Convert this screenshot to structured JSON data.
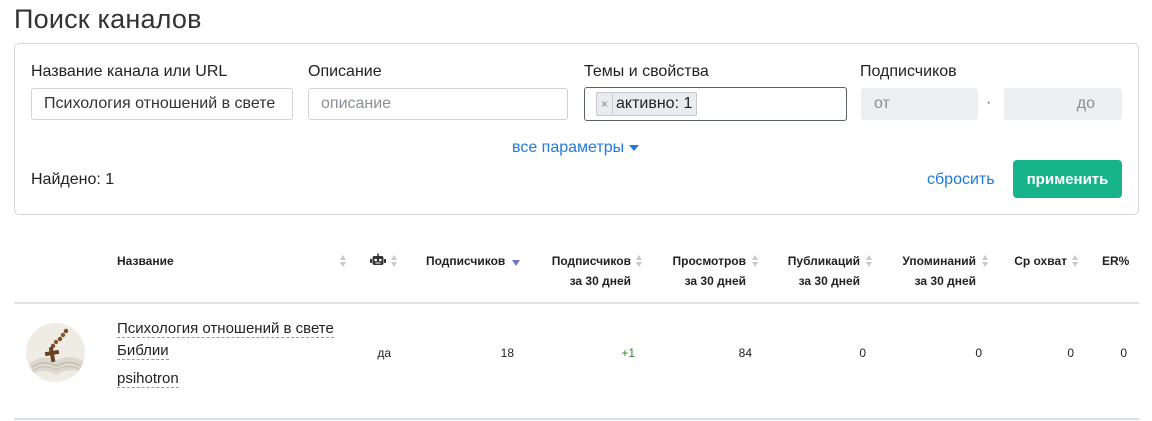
{
  "page": {
    "title": "Поиск каналов"
  },
  "filters": {
    "name_label": "Название канала или URL",
    "name_value": "Психология отношений в свете",
    "description_label": "Описание",
    "description_placeholder": "описание",
    "topics_label": "Темы и свойства",
    "topic_tag": "активно: 1",
    "topic_tag_remove": "×",
    "subscribers_label": "Подписчиков",
    "from_placeholder": "от",
    "to_placeholder": "до",
    "range_separator": "·",
    "all_params": "все параметры",
    "found": "Найдено: 1",
    "reset": "сбросить",
    "apply": "применить"
  },
  "table": {
    "headers": {
      "name": "Название",
      "subscribers": "Подписчиков",
      "subs30_1": "Подписчиков",
      "subs30_2": "за 30 дней",
      "views30_1": "Просмотров",
      "views30_2": "за 30 дней",
      "pubs30_1": "Публикаций",
      "pubs30_2": "за 30 дней",
      "mentions30_1": "Упоминаний",
      "mentions30_2": "за 30 дней",
      "reach": "Ср охват",
      "er": "ER%"
    },
    "rows": [
      {
        "name_line1": "Психология отношений в свете",
        "name_line2": "Библии",
        "handle": "psihotron",
        "bot": "да",
        "subscribers": "18",
        "subs30": "+1",
        "views30": "84",
        "pubs30": "0",
        "mentions30": "0",
        "reach": "0",
        "er": "0"
      }
    ]
  },
  "colors": {
    "accent": "#1f7ae0",
    "apply": "#17b38a",
    "positive": "#2a8a2a"
  }
}
